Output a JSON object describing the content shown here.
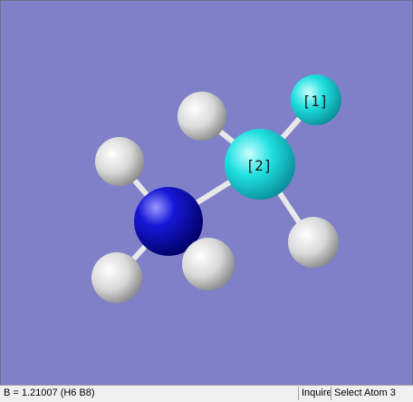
{
  "viewer": {
    "background": "#8080c9",
    "atom_labels": {
      "atom1": "[1]",
      "atom2": "[2]"
    },
    "atom_colors": {
      "hydrogen": "#f2f2f2",
      "fluorine": "#2ee6e6",
      "boron": "#2ee6e6",
      "nitrogen": "#1010cc"
    }
  },
  "statusbar": {
    "measurement": "B = 1.21007 (H6 B8)",
    "mode": "Inquire",
    "prompt": "Select Atom 3"
  }
}
